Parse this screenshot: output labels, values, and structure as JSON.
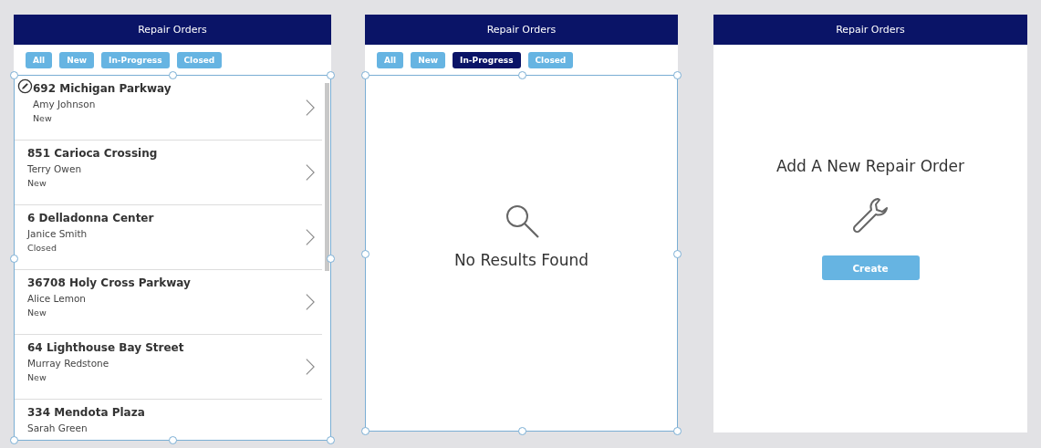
{
  "screens": [
    {
      "kind": "list",
      "title": "Repair Orders",
      "filters": [
        {
          "label": "All",
          "selected": false
        },
        {
          "label": "New",
          "selected": false
        },
        {
          "label": "In-Progress",
          "selected": false
        },
        {
          "label": "Closed",
          "selected": false
        }
      ],
      "rows": [
        {
          "address": "692 Michigan Parkway",
          "name": "Amy Johnson",
          "status": "New"
        },
        {
          "address": "851 Carioca Crossing",
          "name": "Terry Owen",
          "status": "New"
        },
        {
          "address": "6 Delladonna Center",
          "name": "Janice Smith",
          "status": "Closed"
        },
        {
          "address": "36708 Holy Cross Parkway",
          "name": "Alice Lemon",
          "status": "New"
        },
        {
          "address": "64 Lighthouse Bay Street",
          "name": "Murray Redstone",
          "status": "New"
        },
        {
          "address": "334 Mendota Plaza",
          "name": "Sarah Green"
        }
      ]
    },
    {
      "kind": "empty",
      "title": "Repair Orders",
      "filters": [
        {
          "label": "All",
          "selected": false
        },
        {
          "label": "New",
          "selected": false
        },
        {
          "label": "In-Progress",
          "selected": true
        },
        {
          "label": "Closed",
          "selected": false
        }
      ],
      "message": "No Results Found"
    },
    {
      "kind": "create",
      "title": "Repair Orders",
      "heading": "Add A New Repair Order",
      "button": "Create"
    }
  ]
}
